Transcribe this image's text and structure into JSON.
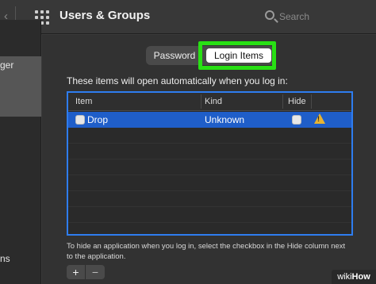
{
  "window": {
    "title": "Users & Groups"
  },
  "search": {
    "placeholder": "Search"
  },
  "sidebar": {
    "selected_item_label": "ger",
    "bottom_item_label": "ns"
  },
  "tabs": [
    {
      "label": "Password",
      "selected": false
    },
    {
      "label": "Login Items",
      "selected": true
    }
  ],
  "description": "These items will open automatically when you log in:",
  "table": {
    "columns": [
      "Item",
      "Kind",
      "Hide"
    ],
    "rows": [
      {
        "item": "Drop",
        "kind": "Unknown",
        "hide_checked": false,
        "warning": true,
        "selected": true
      }
    ]
  },
  "footer_note": "To hide an application when you log in, select the checkbox in the Hide column next to the application.",
  "buttons": {
    "add": "+",
    "remove": "−"
  },
  "watermark": {
    "part1": "wiki",
    "part2": "How"
  },
  "colors": {
    "selection": "#1f5ec9",
    "highlight_box": "#28e014",
    "table_focus_ring": "#2e7df0",
    "warning": "#e8b431"
  }
}
